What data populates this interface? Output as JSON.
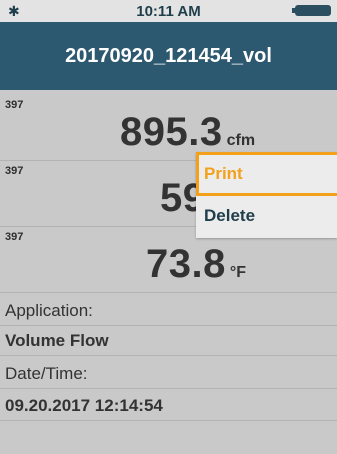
{
  "status": {
    "time": "10:11 AM",
    "bluetooth_icon": "bluetooth-icon",
    "battery_icon": "battery-icon"
  },
  "header": {
    "title": "20170920_121454_vol"
  },
  "readings": [
    {
      "tag": "397",
      "value": "895.3",
      "unit": "cfm"
    },
    {
      "tag": "397",
      "value": "59",
      "unit": ""
    },
    {
      "tag": "397",
      "value": "73.8",
      "unit": "°F"
    }
  ],
  "details": {
    "application_label": "Application:",
    "application_value": "Volume Flow",
    "datetime_label": "Date/Time:",
    "datetime_value": "09.20.2017 12:14:54"
  },
  "menu": {
    "items": [
      {
        "label": "Print",
        "selected": true
      },
      {
        "label": "Delete",
        "selected": false
      }
    ]
  },
  "colors": {
    "header_bg": "#2c5870",
    "accent": "#f3a11b",
    "content_bg": "#c9c9c9"
  }
}
